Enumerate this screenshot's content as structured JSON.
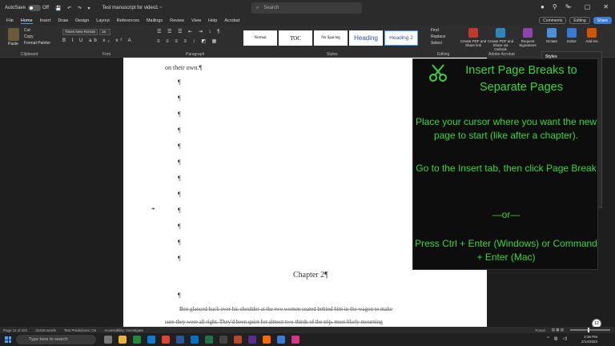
{
  "titlebar": {
    "autosave_label": "AutoSave",
    "autosave_state": "Off",
    "doc_title": "Test manuscript for video1 ~",
    "search_placeholder": "Search"
  },
  "menu": {
    "tabs": [
      "File",
      "Home",
      "Insert",
      "Draw",
      "Design",
      "Layout",
      "References",
      "Mailings",
      "Review",
      "View",
      "Help",
      "Acrobat"
    ],
    "comments": "Comments",
    "editing": "Editing",
    "share": "Share"
  },
  "ribbon": {
    "paste": "Paste",
    "clipboard_items": [
      "Cut",
      "Copy",
      "Format Painter"
    ],
    "font_name": "Times New Roman",
    "font_size": "16",
    "styles": [
      "Normal",
      "TOC",
      "No Spacing",
      "Heading",
      "Heading 2"
    ],
    "editing_items": [
      "Find",
      "Replace",
      "Select"
    ],
    "groups": [
      "Clipboard",
      "Font",
      "Paragraph",
      "Styles",
      "Editing",
      "Adobe Acrobat"
    ],
    "acrobat_buttons": [
      "Create PDF and Share link",
      "Create PDF and Share via Outlook",
      "Request Signatures"
    ],
    "dictate": "Dictate",
    "editor": "Editor",
    "addins": "Add-ins"
  },
  "document": {
    "first_line": "on their own.¶",
    "pilcrow": "¶",
    "chapter": "Chapter 2¶",
    "body_lines": [
      "Ben glanced back over his shoulder at the two women seated behind him in the wagon to make",
      "sure they were all right. They'd been quiet for almost two-thirds of the trip, most likely mourning"
    ]
  },
  "styles_pane": {
    "title": "Styles"
  },
  "overlay": {
    "title": "Insert Page Breaks to Separate Pages",
    "step1": "Place your cursor where you want the new page to start (like after a chapter).",
    "step2": "Go to the Insert tab, then click Page Break",
    "separator": "—or—",
    "step3": "Press Ctrl + Enter (Windows) or Command + Enter (Mac)",
    "accent_color": "#39d63a"
  },
  "statusbar": {
    "page": "Page 11 of 101",
    "words": "31415 words",
    "predictions": "Text Predictions: On",
    "accessibility": "Accessibility: Investigate",
    "focus": "Focus"
  },
  "taskbar": {
    "search": "Type here to search",
    "time": "2:36 PM",
    "date": "2/14/2023",
    "notifications": "12"
  }
}
